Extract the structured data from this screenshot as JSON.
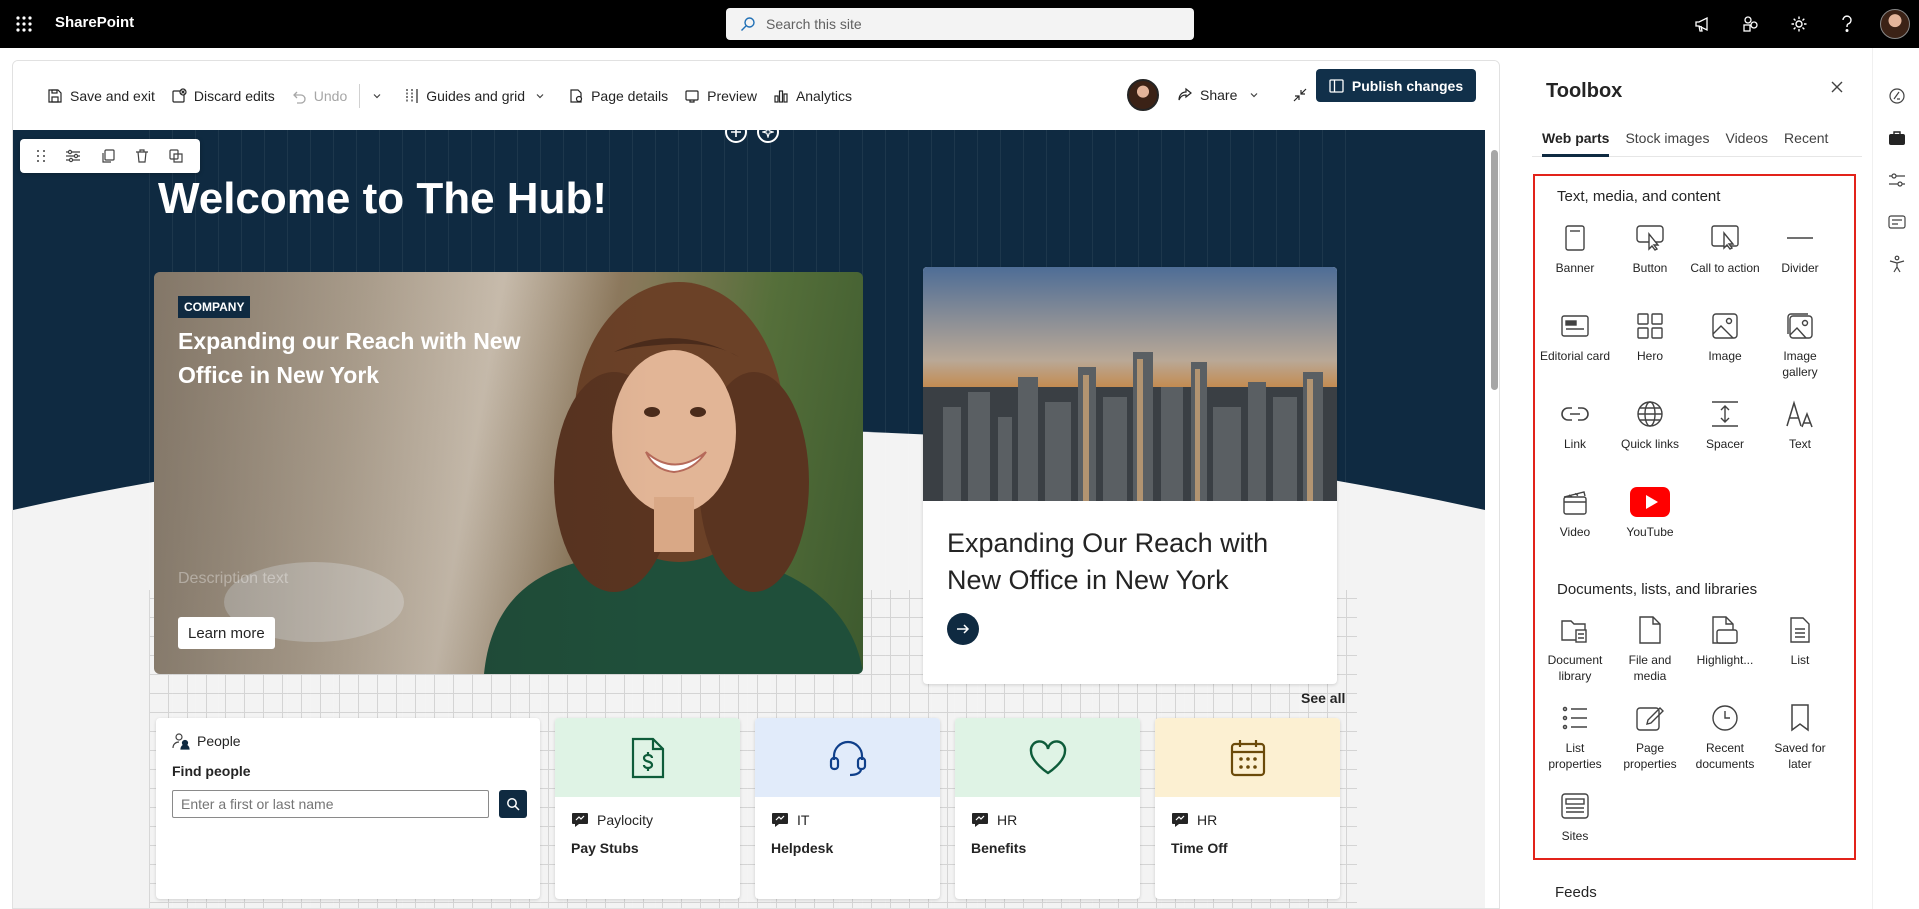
{
  "suite": {
    "app_name": "SharePoint",
    "search_placeholder": "Search this site"
  },
  "commandbar": {
    "save_exit": "Save and exit",
    "discard": "Discard edits",
    "undo": "Undo",
    "guides": "Guides and grid",
    "page_details": "Page details",
    "preview": "Preview",
    "analytics": "Analytics",
    "share": "Share",
    "publish": "Publish changes"
  },
  "hero": {
    "welcome": "Welcome to The Hub!",
    "main_card": {
      "badge": "COMPANY",
      "title": "Expanding our Reach with New Office in New York",
      "description": "Description text",
      "button": "Learn more"
    },
    "side_card": {
      "title": "Expanding Our Reach with New Office in New York"
    },
    "see_all": "See all"
  },
  "people": {
    "header": "People",
    "find": "Find people",
    "input_placeholder": "Enter a first or last name"
  },
  "tiles": [
    {
      "category": "Paylocity",
      "title": "Pay Stubs",
      "bg": "#dff3e5",
      "color": "#0e5c3a",
      "icon": "dollar-document-icon"
    },
    {
      "category": "IT",
      "title": "Helpdesk",
      "bg": "#e1ebfa",
      "color": "#0f3f8a",
      "icon": "headset-icon"
    },
    {
      "category": "HR",
      "title": "Benefits",
      "bg": "#dff3e5",
      "color": "#0e5c3a",
      "icon": "heart-icon"
    },
    {
      "category": "HR",
      "title": "Time Off",
      "bg": "#fcf0d2",
      "color": "#6b4a0a",
      "icon": "calendar-icon"
    }
  ],
  "toolbox": {
    "title": "Toolbox",
    "tabs": [
      "Web parts",
      "Stock images",
      "Videos",
      "Recent"
    ],
    "section1": "Text, media, and content",
    "section1_items": [
      "Banner",
      "Button",
      "Call to action",
      "Divider",
      "Editorial card",
      "Hero",
      "Image",
      "Image gallery",
      "Link",
      "Quick links",
      "Spacer",
      "Text",
      "Video",
      "YouTube"
    ],
    "section2": "Documents, lists, and libraries",
    "section2_items": [
      "Document library",
      "File and media",
      "Highlight...",
      "List",
      "List properties",
      "Page properties",
      "Recent documents",
      "Saved for later",
      "Sites"
    ],
    "feeds": "Feeds"
  },
  "colors": {
    "brand_navy": "#0f2a41",
    "highlight_border": "#e2231a",
    "youtube_red": "#ff0000"
  }
}
